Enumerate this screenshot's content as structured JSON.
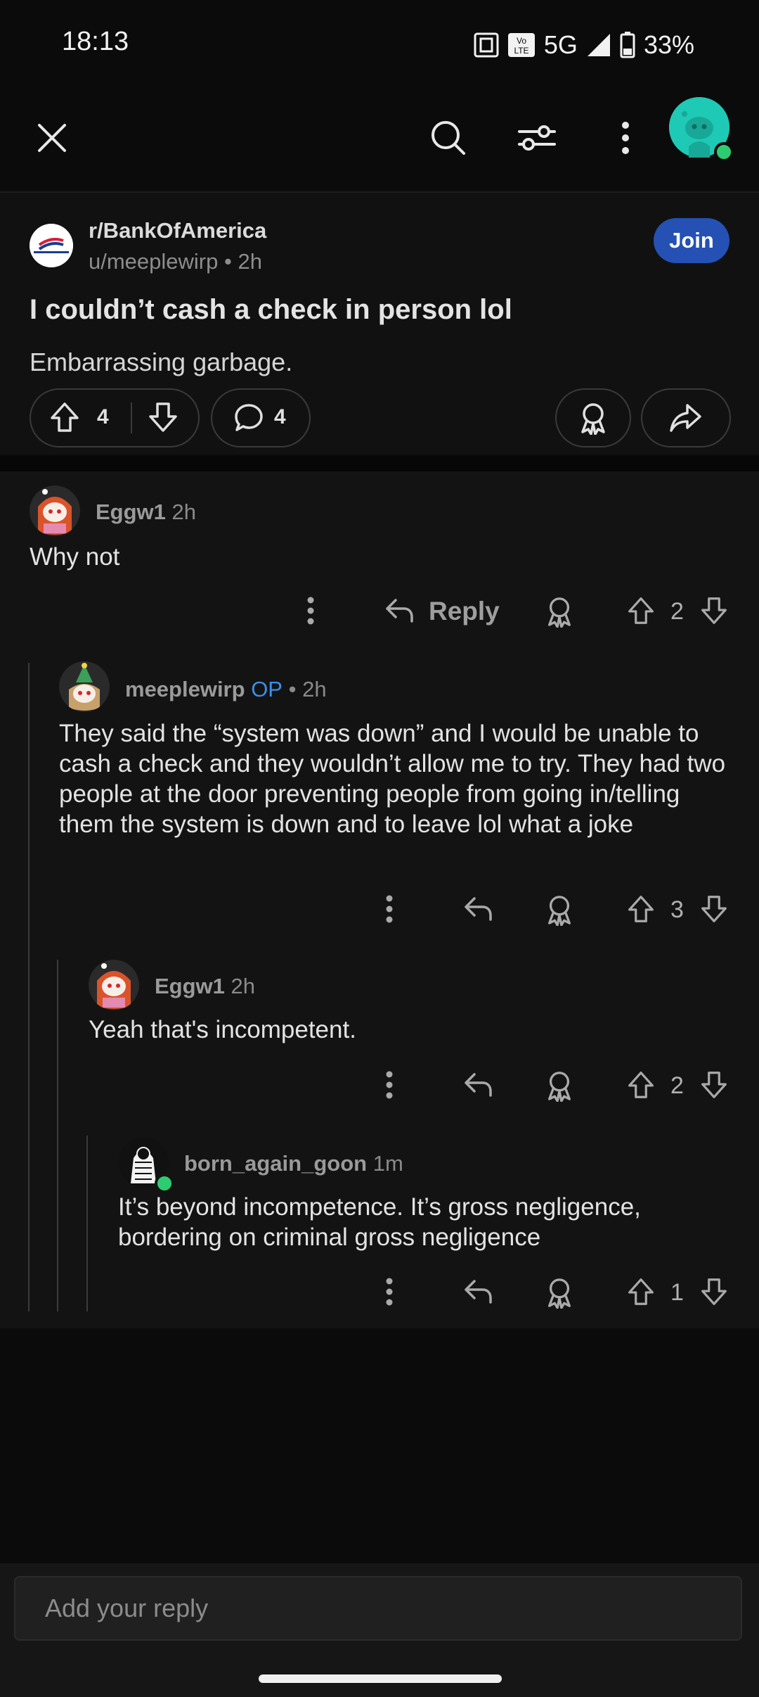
{
  "status_bar": {
    "time": "18:13",
    "network": "5G",
    "battery": "33%",
    "volte": "Vo LTE"
  },
  "top_bar": {
    "icons": [
      "close-icon",
      "search-icon",
      "filter-icon",
      "more-vertical-icon",
      "user-avatar"
    ]
  },
  "post": {
    "subreddit": "r/BankOfAmerica",
    "author": "u/meeplewirp",
    "time": "2h",
    "join_label": "Join",
    "title": "I couldn’t cash a check in person lol",
    "body": "Embarrassing garbage.",
    "votes": "4",
    "comments": "4"
  },
  "comments": [
    {
      "user": "Eggw1",
      "op": "",
      "time": "2h",
      "text": "Why not",
      "votes": "2",
      "reply_label": "Reply"
    },
    {
      "user": "meeplewirp",
      "op": "OP",
      "time": "2h",
      "text": "They said the “system was down” and I would be unable to cash a check and they wouldn’t allow me to try. They had two people at the door preventing people from going in/telling them the system is down and to leave lol what a joke",
      "votes": "3"
    },
    {
      "user": "Eggw1",
      "op": "",
      "time": "2h",
      "text": "Yeah that's incompetent.",
      "votes": "2"
    },
    {
      "user": "born_again_goon",
      "op": "",
      "time": "1m",
      "text": "It’s beyond incompetence. It’s gross negligence, bordering on criminal gross negligence",
      "votes": "1"
    }
  ],
  "reply_bar": {
    "placeholder": "Add your reply"
  },
  "colors": {
    "background": "#0b0b0b",
    "join": "#2451b3",
    "op": "#3b8fe8",
    "online": "#2ecc71",
    "avatar": "#1ec9b5"
  }
}
